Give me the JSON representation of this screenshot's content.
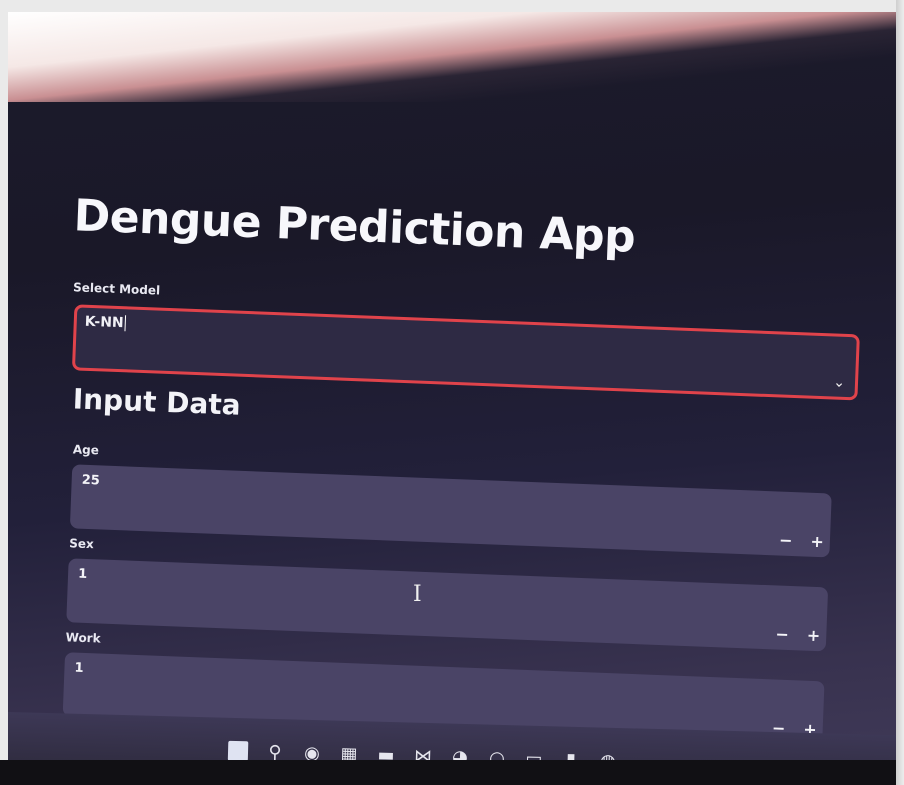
{
  "app": {
    "title": "Dengue Prediction App"
  },
  "model_select": {
    "label": "Select Model",
    "value": "K-NN"
  },
  "input_section": {
    "title": "Input Data",
    "fields": [
      {
        "label": "Age",
        "value": "25",
        "decrement": "−",
        "increment": "+"
      },
      {
        "label": "Sex",
        "value": "1",
        "decrement": "−",
        "increment": "+"
      },
      {
        "label": "Work",
        "value": "1",
        "decrement": "−",
        "increment": "+"
      }
    ]
  },
  "icons": {
    "chevron": "chevron-down-icon",
    "text_cursor": "text-cursor-icon",
    "taskbar": [
      "start-icon",
      "search-icon",
      "chat-icon",
      "task-view-icon",
      "file-explorer-icon",
      "vscode-icon",
      "edge-icon",
      "settings-icon",
      "window-icon",
      "notes-icon",
      "chrome-icon"
    ]
  },
  "glyphs": {
    "chevron": "⌄",
    "text_cursor": "I",
    "taskbar": [
      "",
      "⚲",
      "◉",
      "▦",
      "▬",
      "⋈",
      "◕",
      "○",
      "▭",
      "▮",
      "◍"
    ]
  }
}
